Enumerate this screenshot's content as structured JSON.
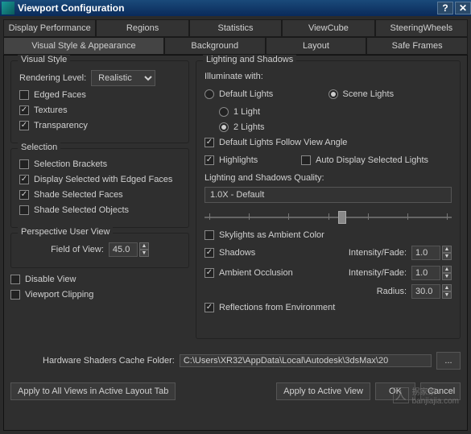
{
  "window": {
    "title": "Viewport Configuration"
  },
  "tabs_top": [
    "Display Performance",
    "Regions",
    "Statistics",
    "ViewCube",
    "SteeringWheels"
  ],
  "tabs_bottom": [
    "Visual Style & Appearance",
    "Background",
    "Layout",
    "Safe Frames"
  ],
  "active_tab": "Visual Style & Appearance",
  "visual_style": {
    "legend": "Visual Style",
    "rendering_label": "Rendering Level:",
    "rendering_value": "Realistic",
    "edged_faces": "Edged Faces",
    "textures": "Textures",
    "transparency": "Transparency"
  },
  "selection": {
    "legend": "Selection",
    "brackets": "Selection Brackets",
    "disp_edged": "Display Selected with Edged Faces",
    "shade_faces": "Shade Selected Faces",
    "shade_objects": "Shade Selected Objects"
  },
  "perspective": {
    "legend": "Perspective User View",
    "fov_label": "Field of View:",
    "fov_value": "45.0"
  },
  "disable_view": "Disable View",
  "viewport_clipping": "Viewport Clipping",
  "lighting": {
    "legend": "Lighting and Shadows",
    "illuminate": "Illuminate with:",
    "default_lights": "Default Lights",
    "scene_lights": "Scene Lights",
    "one_light": "1 Light",
    "two_lights": "2 Lights",
    "follow_view": "Default Lights Follow View Angle",
    "highlights": "Highlights",
    "auto_display": "Auto Display Selected Lights",
    "quality_label": "Lighting and Shadows Quality:",
    "quality_value": "1.0X - Default",
    "skylights": "Skylights as Ambient Color",
    "shadows": "Shadows",
    "ambient_occ": "Ambient Occlusion",
    "reflections": "Reflections from Environment",
    "intensity_label": "Intensity/Fade:",
    "intensity_value": "1.0",
    "intensity2_value": "1.0",
    "radius_label": "Radius:",
    "radius_value": "30.0"
  },
  "shaders": {
    "label": "Hardware Shaders Cache Folder:",
    "path": "C:\\Users\\XR32\\AppData\\Local\\Autodesk\\3dsMax\\20",
    "browse": "..."
  },
  "buttons": {
    "apply_all": "Apply to All Views in Active Layout Tab",
    "apply_active": "Apply to Active View",
    "ok": "OK",
    "cancel": "Cancel"
  },
  "watermark": {
    "brand": "拐家家",
    "site": "banjiajia.com"
  }
}
